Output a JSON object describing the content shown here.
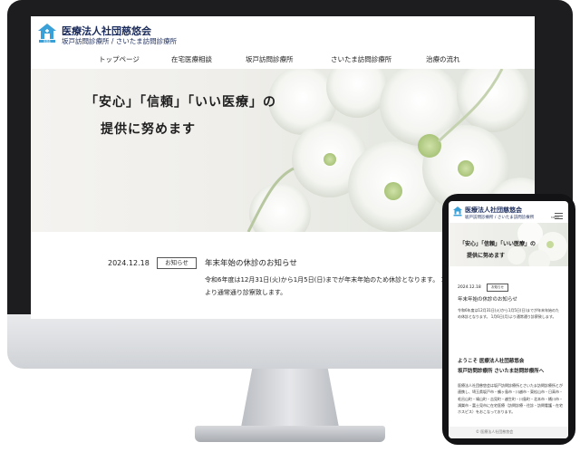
{
  "site": {
    "logo_text": "慈悠会",
    "title": "医療法人社団慈悠会",
    "subtitle": "坂戸訪問診療所 / さいたま訪問診療所"
  },
  "nav": {
    "items": [
      {
        "label": "トップページ"
      },
      {
        "label": "在宅医療相談"
      },
      {
        "label": "坂戸訪問診療所"
      },
      {
        "label": "さいたま訪問診療所"
      },
      {
        "label": "治療の流れ"
      }
    ]
  },
  "hero": {
    "tagline_line1": "「安心」「信頼」「いい医療」の",
    "tagline_line2": "提供に努めます"
  },
  "news": {
    "date": "2024.12.18",
    "badge": "お知らせ",
    "title": "年末年始の休診のお知らせ",
    "body": "令和6年度は12月31日(火)から1月5日(日)までが年末年始のため休診となります。 1月6日(月)より通常通り診察致します。"
  },
  "mobile": {
    "title": "医療法人社団慈悠会",
    "subtitle": "坂戸訪問診療所 / さいたま訪問診療所",
    "menu_label": "MENU",
    "tagline_line1": "「安心」「信頼」「いい医療」の",
    "tagline_line2": "提供に努めます",
    "news_date": "2024.12.18",
    "news_badge": "お知らせ",
    "news_title": "年末年始の休診のお知らせ",
    "news_body": "令和6年度は12月31日(火)から1月5日(日)までが年末年始のため休診となります。 1月6日(月)より通常通り診察致します。",
    "welcome_line1": "ようこそ 医療法人社団慈悠会",
    "welcome_line2": "坂戸訪問診療所 さいたま訪問診療所へ",
    "about": "医療法人社団慈悠会は坂戸訪問診療所とさいたま訪問診療所とが連携し、埼玉県坂戸市・鶴ヶ島市・川越市・東松山市・日高市・毛呂山町・鳩山町・吉見町・越生町・川島町・北本市・桶川市・鴻巣市・富士見市に在宅医療（訪問診療・往診・訪問看護・在宅ホスピス）をおこなっております。",
    "footer": "© 医療法人社団慈悠会"
  },
  "colors": {
    "brand_navy": "#1a2b5c",
    "logo_blue": "#3aa0d8",
    "device_black": "#1d1d1f"
  }
}
